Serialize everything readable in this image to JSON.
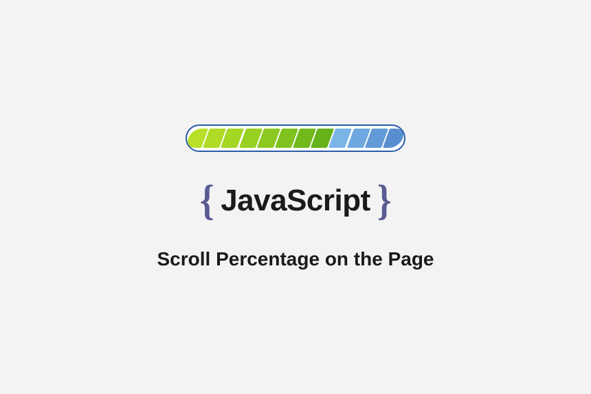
{
  "progress": {
    "segments": 12,
    "filled": 8
  },
  "logo": {
    "brace_left": "{",
    "text": "JavaScript",
    "brace_right": "}"
  },
  "subtitle": "Scroll Percentage on the Page"
}
